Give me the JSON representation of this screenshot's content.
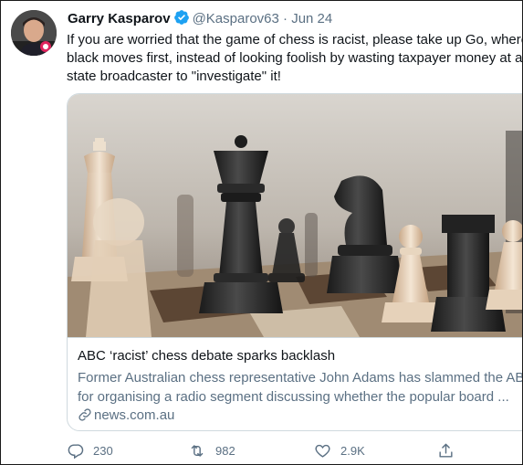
{
  "tweet": {
    "author_name": "Garry Kasparov",
    "handle": "@Kasparov63",
    "separator": "·",
    "date": "Jun 24",
    "text_lines": [
      "If you are worried that the game of chess is racist, please take up Go, where",
      "black moves first, instead of looking foolish by wasting taxpayer money at a",
      "state broadcaster to \"investigate\" it!"
    ]
  },
  "card": {
    "title": "ABC ‘racist’ chess debate sparks backlash",
    "description_lines": [
      "Former Australian chess representative John Adams has slammed the ABC",
      "for organising a radio segment discussing whether the popular board ..."
    ],
    "domain": "news.com.au"
  },
  "actions": {
    "replies": "230",
    "retweets": "982",
    "likes": "2.9K"
  },
  "colors": {
    "text": "#0f1419",
    "secondary": "#5b7083",
    "verified": "#1da1f2",
    "border": "#cfd9de"
  }
}
